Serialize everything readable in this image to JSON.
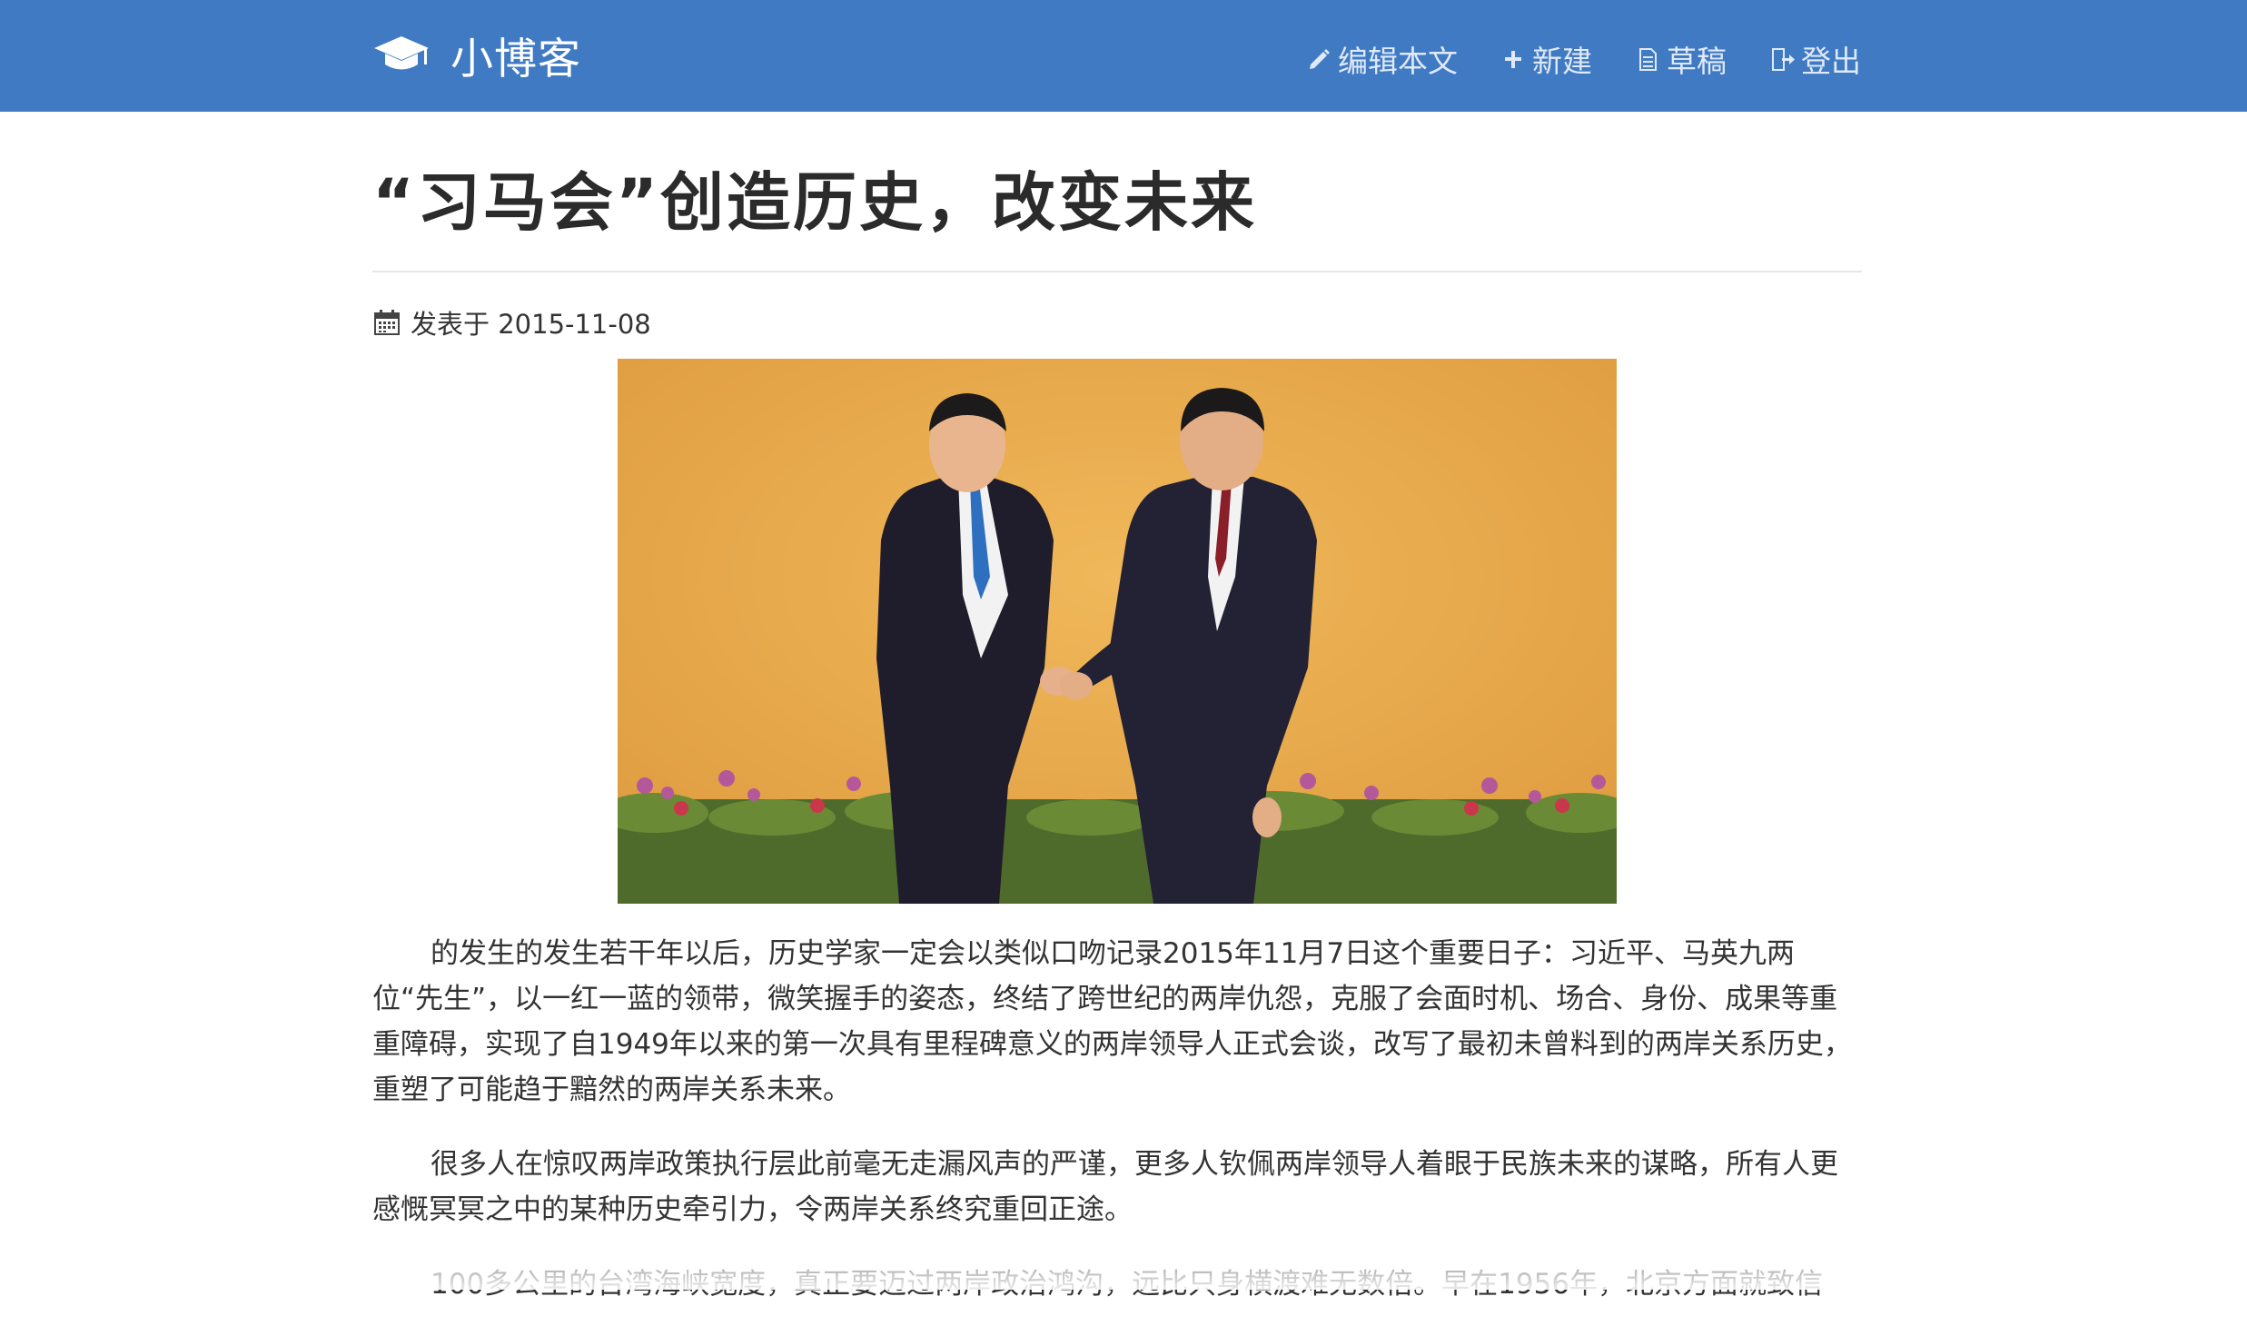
{
  "navbar": {
    "brand_icon": "graduation-cap-icon",
    "brand": "小博客",
    "edit": {
      "icon": "pencil-icon",
      "label": "编辑本文"
    },
    "new": {
      "icon": "plus-icon",
      "label": "新建"
    },
    "drafts": {
      "icon": "document-icon",
      "label": "草稿"
    },
    "logout": {
      "icon": "logout-icon",
      "label": "登出"
    }
  },
  "post": {
    "title": "“习马会”创造历史，改变未来",
    "meta_icon": "calendar-icon",
    "date_label": "发表于 2015-11-08",
    "image_icon": "handshake-photo",
    "paragraphs": [
      "的发生的发生若干年以后，历史学家一定会以类似口吻记录2015年11月7日这个重要日子：习近平、马英九两位“先生”，以一红一蓝的领带，微笑握手的姿态，终结了跨世纪的两岸仇怨，克服了会面时机、场合、身份、成果等重重障碍，实现了自1949年以来的第一次具有里程碑意义的两岸领导人正式会谈，改写了最初未曾料到的两岸关系历史，重塑了可能趋于黯然的两岸关系未来。",
      "很多人在惊叹两岸政策执行层此前毫无走漏风声的严谨，更多人钦佩两岸领导人着眼于民族未来的谋略，所有人更感慨冥冥之中的某种历史牵引力，令两岸关系终究重回正途。",
      "100多公里的台湾海峡宽度，真正要迈过两岸政治鸿沟，远比只身横渡难无数倍。早在1956年，北京方面就致信"
    ]
  },
  "colors": {
    "navbar_bg": "#3f7ac3",
    "text": "#333333",
    "photo_backdrop": "#e9a84a"
  }
}
